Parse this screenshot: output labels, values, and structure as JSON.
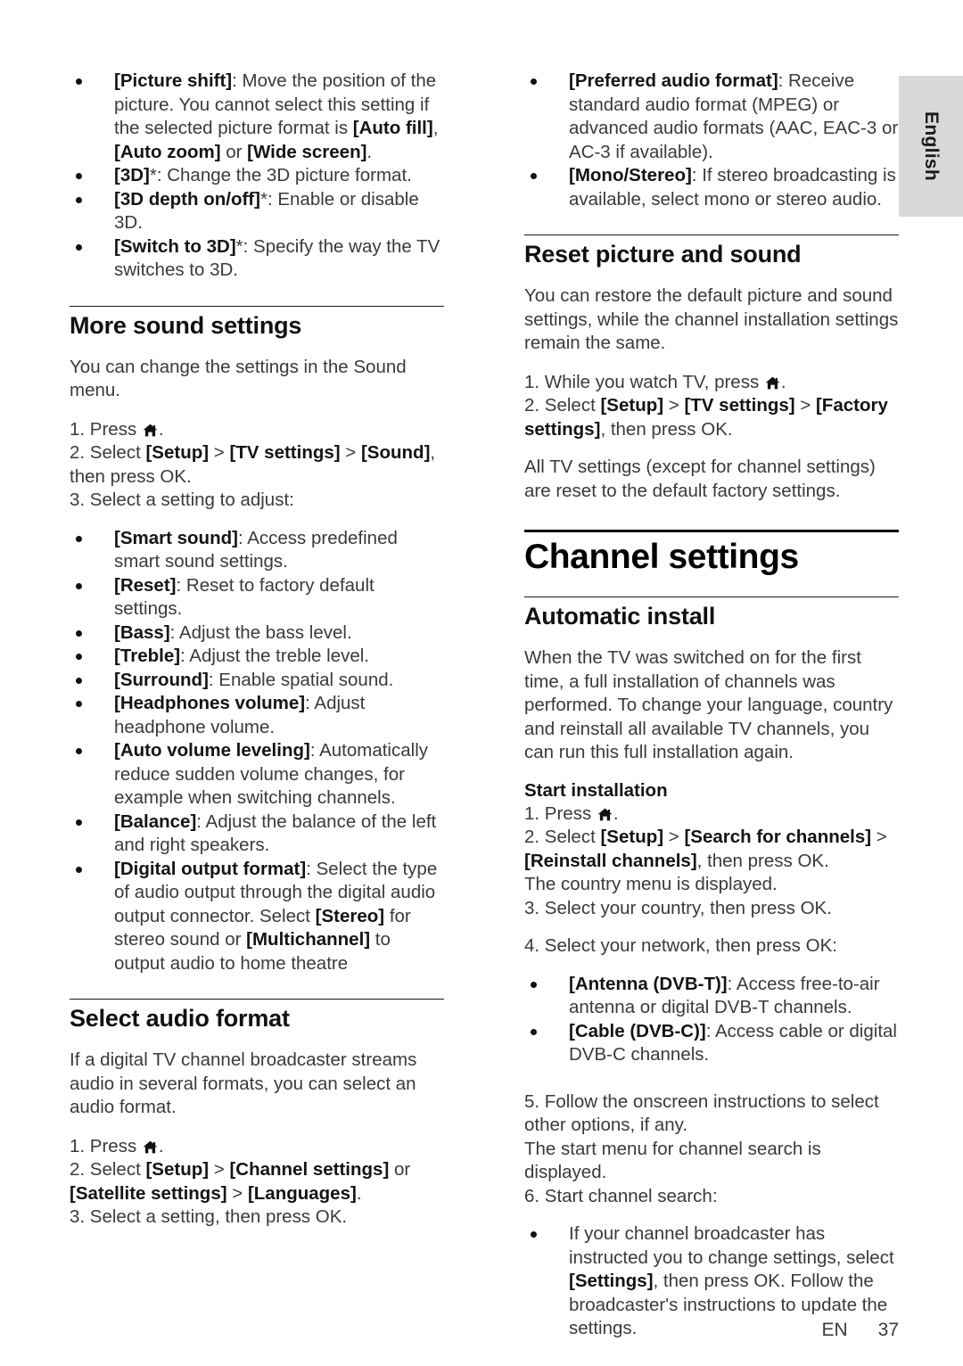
{
  "language_tab": {
    "label": "English"
  },
  "footer": {
    "locale": "EN",
    "page_number": "37"
  },
  "icons": {
    "home": "home-icon"
  },
  "left_column": {
    "picture_bullets": [
      {
        "parts": [
          {
            "t": "[Picture shift]",
            "b": true
          },
          {
            "t": ": Move the position of the picture. You cannot select this setting if the selected picture format is ",
            "b": false
          },
          {
            "t": "[Auto fill]",
            "b": true
          },
          {
            "t": ", ",
            "b": false
          },
          {
            "t": "[Auto zoom]",
            "b": true
          },
          {
            "t": " or ",
            "b": false
          },
          {
            "t": "[Wide screen]",
            "b": true
          },
          {
            "t": ".",
            "b": false
          }
        ]
      },
      {
        "parts": [
          {
            "t": "[3D]",
            "b": true
          },
          {
            "t": "*: Change the 3D picture format.",
            "b": false
          }
        ]
      },
      {
        "parts": [
          {
            "t": "[3D depth on/off]",
            "b": true
          },
          {
            "t": "*: Enable or disable 3D.",
            "b": false
          }
        ]
      },
      {
        "parts": [
          {
            "t": "[Switch to 3D]",
            "b": true
          },
          {
            "t": "*: Specify the way the TV switches to 3D.",
            "b": false
          }
        ]
      }
    ],
    "more_sound_settings": {
      "heading": "More sound settings",
      "intro": "You can change the settings in the Sound menu.",
      "steps": [
        {
          "parts": [
            {
              "t": "1. Press ",
              "b": false
            },
            {
              "icon": "home"
            },
            {
              "t": ".",
              "b": false
            }
          ]
        },
        {
          "parts": [
            {
              "t": "2. Select ",
              "b": false
            },
            {
              "t": "[Setup]",
              "b": true
            },
            {
              "t": " > ",
              "b": false
            },
            {
              "t": "[TV settings]",
              "b": true
            },
            {
              "t": " > ",
              "b": false
            },
            {
              "t": "[Sound]",
              "b": true
            },
            {
              "t": ", then press ",
              "b": false
            },
            {
              "t": "OK",
              "b": false,
              "ok": true
            },
            {
              "t": ".",
              "b": false
            }
          ]
        },
        {
          "parts": [
            {
              "t": "3. Select a setting to adjust:",
              "b": false
            }
          ]
        }
      ],
      "bullets": [
        {
          "parts": [
            {
              "t": "[Smart sound]",
              "b": true
            },
            {
              "t": ": Access predefined smart sound settings.",
              "b": false
            }
          ]
        },
        {
          "parts": [
            {
              "t": "[Reset]",
              "b": true
            },
            {
              "t": ": Reset to factory default settings.",
              "b": false
            }
          ]
        },
        {
          "parts": [
            {
              "t": "[Bass]",
              "b": true
            },
            {
              "t": ": Adjust the bass level.",
              "b": false
            }
          ]
        },
        {
          "parts": [
            {
              "t": "[Treble]",
              "b": true
            },
            {
              "t": ": Adjust the treble level.",
              "b": false
            }
          ]
        },
        {
          "parts": [
            {
              "t": "[Surround]",
              "b": true
            },
            {
              "t": ": Enable spatial sound.",
              "b": false
            }
          ]
        },
        {
          "parts": [
            {
              "t": "[Headphones volume]",
              "b": true
            },
            {
              "t": ": Adjust headphone volume.",
              "b": false
            }
          ]
        },
        {
          "parts": [
            {
              "t": "[Auto volume leveling]",
              "b": true
            },
            {
              "t": ": Automatically reduce sudden volume changes, for example when switching channels.",
              "b": false
            }
          ]
        },
        {
          "parts": [
            {
              "t": "[Balance]",
              "b": true
            },
            {
              "t": ": Adjust the balance of the left and right speakers.",
              "b": false
            }
          ]
        },
        {
          "parts": [
            {
              "t": "[Digital output format]",
              "b": true
            },
            {
              "t": ": Select the type of audio output through the digital audio output connector. Select ",
              "b": false
            },
            {
              "t": "[Stereo]",
              "b": true
            },
            {
              "t": " for stereo sound or ",
              "b": false
            },
            {
              "t": "[Multichannel]",
              "b": true
            },
            {
              "t": " to output audio to home theatre",
              "b": false
            }
          ]
        }
      ]
    },
    "select_audio_format": {
      "heading": "Select audio format",
      "intro": "If a digital TV channel broadcaster streams audio in several formats, you can select an audio format.",
      "steps": [
        {
          "parts": [
            {
              "t": "1. Press ",
              "b": false
            },
            {
              "icon": "home"
            },
            {
              "t": ".",
              "b": false
            }
          ]
        },
        {
          "parts": [
            {
              "t": "2. Select ",
              "b": false
            },
            {
              "t": "[Setup]",
              "b": true
            },
            {
              "t": " > ",
              "b": false
            },
            {
              "t": "[Channel settings]",
              "b": true
            },
            {
              "t": " or ",
              "b": false
            },
            {
              "t": "[Satellite settings]",
              "b": true
            },
            {
              "t": " > ",
              "b": false
            },
            {
              "t": "[Languages]",
              "b": true
            },
            {
              "t": ".",
              "b": false
            }
          ]
        },
        {
          "parts": [
            {
              "t": "3. Select a setting, then press ",
              "b": false
            },
            {
              "t": "OK",
              "b": false,
              "ok": true
            },
            {
              "t": ".",
              "b": false
            }
          ]
        }
      ]
    }
  },
  "right_column": {
    "audio_bullets": [
      {
        "parts": [
          {
            "t": "[Preferred audio format]",
            "b": true
          },
          {
            "t": ": Receive standard audio format (MPEG) or advanced audio formats (AAC, EAC-3 or AC-3 if available).",
            "b": false
          }
        ]
      },
      {
        "parts": [
          {
            "t": "[Mono/Stereo]",
            "b": true
          },
          {
            "t": ": If stereo broadcasting is available, select mono or stereo audio.",
            "b": false
          }
        ]
      }
    ],
    "reset_picture_and_sound": {
      "heading": "Reset picture and sound",
      "intro": "You can restore the default picture and sound settings, while the channel installation settings remain the same.",
      "steps": [
        {
          "parts": [
            {
              "t": "1. While you watch TV, press ",
              "b": false
            },
            {
              "icon": "home"
            },
            {
              "t": ".",
              "b": false
            }
          ]
        },
        {
          "parts": [
            {
              "t": "2. Select ",
              "b": false
            },
            {
              "t": "[Setup]",
              "b": true
            },
            {
              "t": " > ",
              "b": false
            },
            {
              "t": "[TV settings]",
              "b": true
            },
            {
              "t": " > ",
              "b": false
            },
            {
              "t": "[Factory settings]",
              "b": true
            },
            {
              "t": ", then press ",
              "b": false
            },
            {
              "t": "OK",
              "b": false,
              "ok": true
            },
            {
              "t": ".",
              "b": false
            }
          ]
        }
      ],
      "outro": "All TV settings (except for channel settings) are reset to the default factory settings."
    },
    "chapter": {
      "title": "Channel settings"
    },
    "automatic_install": {
      "heading": "Automatic install",
      "intro": "When the TV was switched on for the first time, a full installation of channels was performed. To change your language, country and reinstall all available TV channels, you can run this full installation again.",
      "subheading": "Start installation",
      "steps": [
        {
          "parts": [
            {
              "t": "1. Press ",
              "b": false
            },
            {
              "icon": "home"
            },
            {
              "t": ".",
              "b": false
            }
          ]
        },
        {
          "parts": [
            {
              "t": "2. Select ",
              "b": false
            },
            {
              "t": "[Setup]",
              "b": true
            },
            {
              "t": " > ",
              "b": false
            },
            {
              "t": "[Search for channels]",
              "b": true
            },
            {
              "t": " > ",
              "b": false
            },
            {
              "t": "[Reinstall channels]",
              "b": true
            },
            {
              "t": ", then press ",
              "b": false
            },
            {
              "t": "OK",
              "b": false,
              "ok": true
            },
            {
              "t": ".",
              "b": false
            }
          ]
        },
        {
          "parts": [
            {
              "t": "The country menu is displayed.",
              "b": false
            }
          ]
        },
        {
          "parts": [
            {
              "t": "3. Select your country, then press ",
              "b": false
            },
            {
              "t": "OK",
              "b": false,
              "ok": true
            },
            {
              "t": ".",
              "b": false
            }
          ]
        }
      ],
      "step4": {
        "parts": [
          {
            "t": "4. Select your network, then press ",
            "b": false
          },
          {
            "t": "OK",
            "b": false,
            "ok": true
          },
          {
            "t": ":",
            "b": false
          }
        ]
      },
      "network_bullets": [
        {
          "parts": [
            {
              "t": "[Antenna (DVB-T)]",
              "b": true
            },
            {
              "t": ": Access free-to-air antenna or digital DVB-T channels.",
              "b": false
            }
          ]
        },
        {
          "parts": [
            {
              "t": "[Cable (DVB-C)]",
              "b": true
            },
            {
              "t": ": Access cable or digital DVB-C channels.",
              "b": false
            }
          ]
        }
      ],
      "steps_tail": [
        {
          "parts": [
            {
              "t": "5. Follow the onscreen instructions to select other options, if any.",
              "b": false
            }
          ]
        },
        {
          "parts": [
            {
              "t": "The start menu for channel search is displayed.",
              "b": false
            }
          ]
        },
        {
          "parts": [
            {
              "t": "6. Start channel search:",
              "b": false
            }
          ]
        }
      ],
      "final_bullets": [
        {
          "parts": [
            {
              "t": "If your channel broadcaster has instructed you to change settings, select ",
              "b": false
            },
            {
              "t": "[Settings]",
              "b": true
            },
            {
              "t": ", then press ",
              "b": false
            },
            {
              "t": "OK",
              "b": false,
              "ok": true
            },
            {
              "t": ". Follow the broadcaster's instructions to update the settings.",
              "b": false
            }
          ]
        }
      ]
    }
  }
}
